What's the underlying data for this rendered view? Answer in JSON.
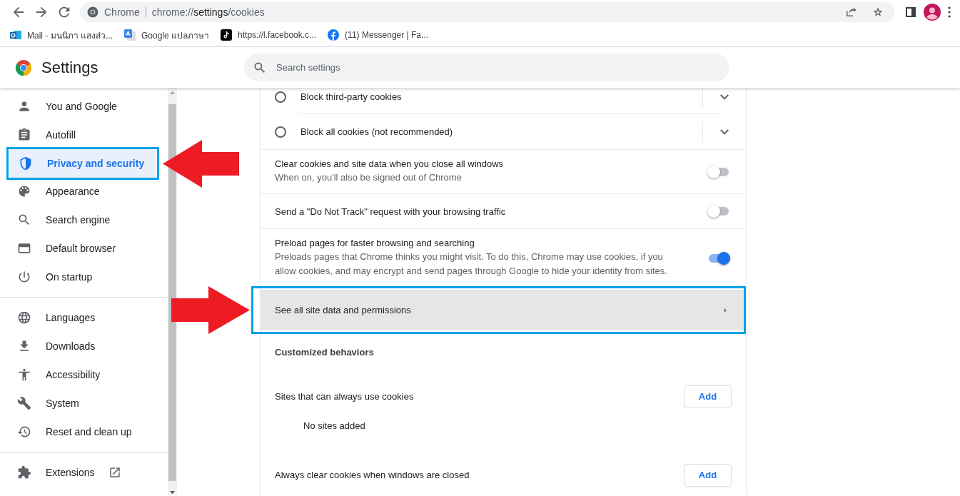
{
  "toolbar": {
    "site_chip": "Chrome",
    "url": {
      "scheme": "chrome://",
      "host": "settings",
      "path": "/cookies"
    }
  },
  "bookmarks": [
    {
      "label": "Mail - มนนิภา แสงส่ว..."
    },
    {
      "label": "Google แปลภาษา"
    },
    {
      "label": "https://l.facebook.c..."
    },
    {
      "label": "(11) Messenger | Fa..."
    }
  ],
  "header": {
    "title": "Settings",
    "search": {
      "placeholder": "Search settings"
    }
  },
  "sidebar": {
    "groups": [
      {
        "items": [
          {
            "label": "You and Google",
            "selected": false,
            "highlighted": false
          },
          {
            "label": "Autofill",
            "selected": false,
            "highlighted": false
          },
          {
            "label": "Privacy and security",
            "selected": true,
            "highlighted": true
          },
          {
            "label": "Appearance",
            "selected": false,
            "highlighted": false
          },
          {
            "label": "Search engine",
            "selected": false,
            "highlighted": false
          },
          {
            "label": "Default browser",
            "selected": false,
            "highlighted": false
          },
          {
            "label": "On startup",
            "selected": false,
            "highlighted": false
          }
        ]
      },
      {
        "items": [
          {
            "label": "Languages",
            "selected": false,
            "highlighted": false
          },
          {
            "label": "Downloads",
            "selected": false,
            "highlighted": false
          },
          {
            "label": "Accessibility",
            "selected": false,
            "highlighted": false
          },
          {
            "label": "System",
            "selected": false,
            "highlighted": false
          },
          {
            "label": "Reset and clean up",
            "selected": false,
            "highlighted": false
          }
        ]
      },
      {
        "items": [
          {
            "label": "Extensions",
            "selected": false,
            "highlighted": false,
            "external": true
          }
        ]
      }
    ]
  },
  "content": {
    "rows": [
      {
        "kind": "radio",
        "label": "Block third-party cookies",
        "selected": false
      },
      {
        "kind": "radio",
        "label": "Block all cookies (not recommended)",
        "selected": false
      },
      {
        "kind": "toggle",
        "label": "Clear cookies and site data when you close all windows",
        "sublabel": "When on, you'll also be signed out of Chrome",
        "on": false
      },
      {
        "kind": "toggle",
        "label": "Send a \"Do Not Track\" request with your browsing traffic",
        "on": false
      },
      {
        "kind": "toggle",
        "label": "Preload pages for faster browsing and searching",
        "sublabel": "Preloads pages that Chrome thinks you might visit. To do this, Chrome may use cookies, if you allow cookies, and may encrypt and send pages through Google to hide your identity from sites.",
        "on": true
      },
      {
        "kind": "link",
        "label": "See all site data and permissions",
        "highlighted": true
      },
      {
        "kind": "heading",
        "label": "Customized behaviors"
      },
      {
        "kind": "add",
        "label": "Sites that can always use cookies",
        "button": "Add"
      },
      {
        "kind": "empty",
        "label": "No sites added"
      },
      {
        "kind": "add",
        "label": "Always clear cookies when windows are closed",
        "button": "Add"
      }
    ]
  }
}
